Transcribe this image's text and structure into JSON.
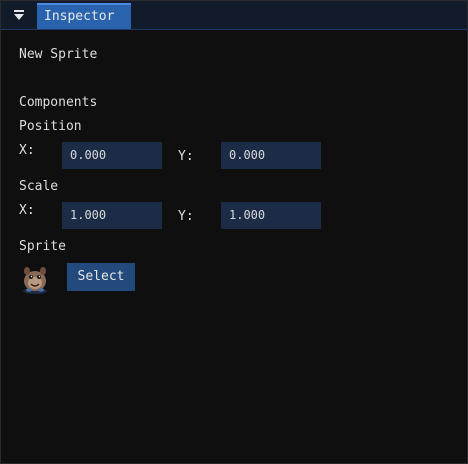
{
  "window": {
    "title": "Inspector"
  },
  "entity": {
    "name": "New Sprite"
  },
  "components": {
    "heading": "Components",
    "position": {
      "label": "Position",
      "x_label": "X:",
      "x_value": "0.000",
      "y_label": "Y:",
      "y_value": "0.000"
    },
    "scale": {
      "label": "Scale",
      "x_label": "X:",
      "x_value": "1.000",
      "y_label": "Y:",
      "y_value": "1.000"
    },
    "sprite": {
      "label": "Sprite",
      "thumbnail_icon": "creature-sprite-icon",
      "select_label": "Select"
    }
  },
  "colors": {
    "tab_active": "#2963ad",
    "field_bg": "#1c2c47",
    "button_bg": "#234a7c",
    "window_bg": "#0f0f0f",
    "text": "#dedede"
  }
}
